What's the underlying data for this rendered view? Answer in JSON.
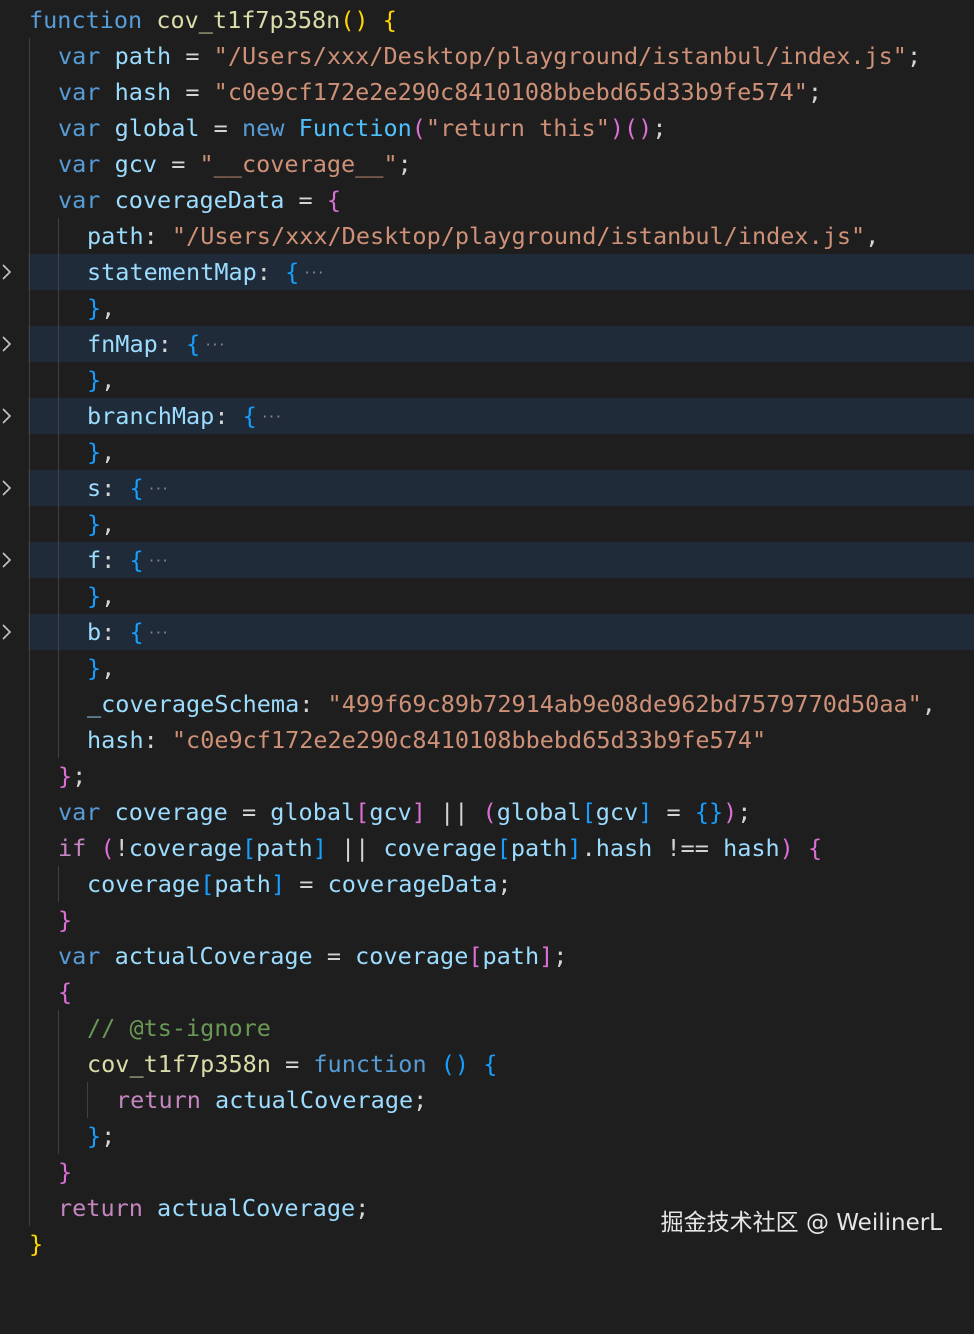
{
  "fn_name": "cov_t1f7p358n",
  "path_value": "\"/Users/xxx/Desktop/playground/istanbul/index.js\"",
  "hash_value": "\"c0e9cf172e2e290c8410108bbebd65d33b9fe574\"",
  "return_this": "\"return this\"",
  "gcv_value": "\"__coverage__\"",
  "schema_value": "\"499f69c89b72914ab9e08de962bd7579770d50aa\"",
  "comment": "// @ts-ignore",
  "fold_marker": "···",
  "folded_keys": [
    "statementMap",
    "fnMap",
    "branchMap",
    "s",
    "f",
    "b"
  ],
  "watermark": "掘金技术社区 @ WeilinerL",
  "colors": {
    "background": "#1e1e1e",
    "folded_highlight": "#1f2b38",
    "keyword": "#569cd6",
    "control": "#c586c0",
    "function": "#dcdcaa",
    "string": "#ce9178",
    "variable": "#9cdcfe",
    "bracket_gold": "#ffd700",
    "bracket_purple": "#da70d6",
    "bracket_blue": "#179fff",
    "comment": "#6a9955"
  }
}
